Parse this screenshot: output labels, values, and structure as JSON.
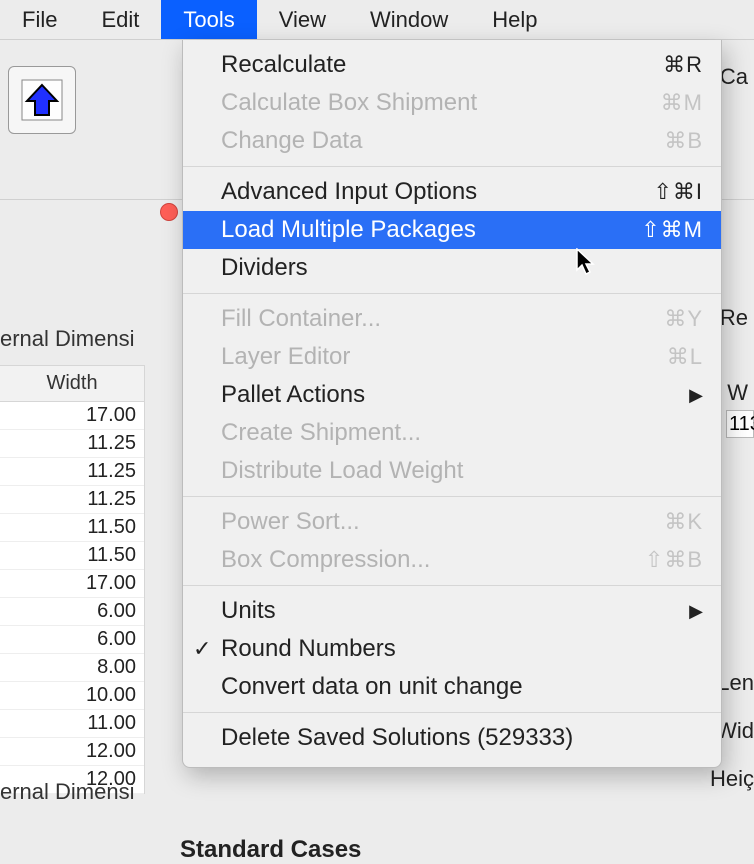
{
  "menubar": {
    "items": [
      {
        "label": "File"
      },
      {
        "label": "Edit"
      },
      {
        "label": "Tools"
      },
      {
        "label": "View"
      },
      {
        "label": "Window"
      },
      {
        "label": "Help"
      }
    ],
    "active_index": 2
  },
  "toolbar": {
    "right_label": "Ca"
  },
  "dropdown": {
    "items": [
      {
        "label": "Recalculate",
        "shortcut": "⌘R",
        "enabled": true
      },
      {
        "label": "Calculate Box Shipment",
        "shortcut": "⌘M",
        "enabled": false
      },
      {
        "label": "Change Data",
        "shortcut": "⌘B",
        "enabled": false
      },
      {
        "type": "sep"
      },
      {
        "label": "Advanced Input Options",
        "shortcut": "⇧⌘I",
        "enabled": true
      },
      {
        "label": "Load Multiple Packages",
        "shortcut": "⇧⌘M",
        "enabled": true,
        "highlight": true
      },
      {
        "label": "Dividers",
        "enabled": true
      },
      {
        "type": "sep"
      },
      {
        "label": "Fill Container...",
        "shortcut": "⌘Y",
        "enabled": false
      },
      {
        "label": "Layer Editor",
        "shortcut": "⌘L",
        "enabled": false
      },
      {
        "label": "Pallet Actions",
        "enabled": true,
        "submenu": true
      },
      {
        "label": "Create Shipment...",
        "enabled": false
      },
      {
        "label": "Distribute Load Weight",
        "enabled": false
      },
      {
        "type": "sep"
      },
      {
        "label": "Power Sort...",
        "shortcut": "⌘K",
        "enabled": false
      },
      {
        "label": "Box Compression...",
        "shortcut": "⇧⌘B",
        "enabled": false
      },
      {
        "type": "sep"
      },
      {
        "label": "Units",
        "enabled": true,
        "submenu": true
      },
      {
        "label": "Round Numbers",
        "enabled": true,
        "checked": true
      },
      {
        "label": "Convert data on unit change",
        "enabled": true
      },
      {
        "type": "sep"
      },
      {
        "label": "Delete Saved Solutions (529333)",
        "enabled": true
      }
    ]
  },
  "panel": {
    "ext_dim_label_1": "ernal Dimensi",
    "ext_dim_label_2": "ernal Dimensi",
    "right_re": "Re",
    "right_w": "W",
    "right_input_value": "113",
    "right_len": "Len",
    "right_wid": "Wid",
    "right_hei": "Heiç",
    "std_cases": "Standard Cases"
  },
  "width_table": {
    "header": "Width",
    "values": [
      "17.00",
      "11.25",
      "11.25",
      "11.25",
      "11.50",
      "11.50",
      "17.00",
      "6.00",
      "6.00",
      "8.00",
      "10.00",
      "11.00",
      "12.00",
      "12.00"
    ]
  }
}
